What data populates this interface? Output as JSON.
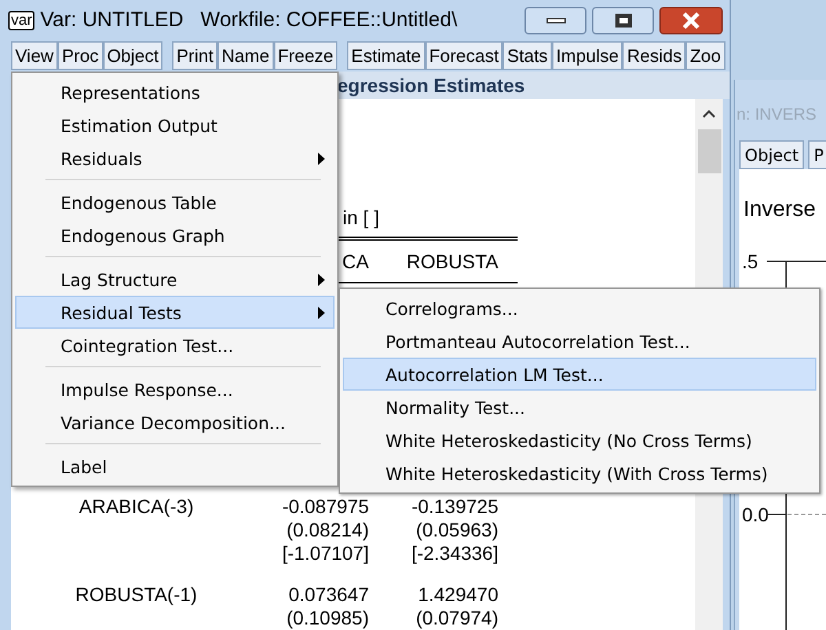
{
  "window": {
    "icon_text": "var",
    "title": "Var: UNTITLED   Workfile: COFFEE::Untitled\\"
  },
  "toolbar_groups": [
    [
      "View",
      "Proc",
      "Object"
    ],
    [
      "Print",
      "Name",
      "Freeze"
    ],
    [
      "Estimate",
      "Forecast",
      "Stats",
      "Impulse",
      "Resids",
      "Zoo"
    ]
  ],
  "output": {
    "header": "egression Estimates",
    "sample_text": "in [ ]",
    "columns": [
      "CA",
      "ROBUSTA"
    ],
    "rows": [
      {
        "label": "ARABICA(-3)",
        "cells": [
          [
            "-0.087975",
            "(0.08214)",
            "[-1.07107]"
          ],
          [
            "-0.139725",
            "(0.05963)",
            "[-2.34336]"
          ]
        ]
      },
      {
        "label": "ROBUSTA(-1)",
        "cells": [
          [
            "0.073647",
            "(0.10985)"
          ],
          [
            "1.429470",
            "(0.07974)"
          ]
        ]
      }
    ]
  },
  "view_menu": [
    {
      "kind": "item",
      "label": "Representations",
      "submenu": false,
      "selected": false
    },
    {
      "kind": "item",
      "label": "Estimation Output",
      "submenu": false,
      "selected": false
    },
    {
      "kind": "item",
      "label": "Residuals",
      "submenu": true,
      "selected": false
    },
    {
      "kind": "separator"
    },
    {
      "kind": "item",
      "label": "Endogenous Table",
      "submenu": false,
      "selected": false
    },
    {
      "kind": "item",
      "label": "Endogenous Graph",
      "submenu": false,
      "selected": false
    },
    {
      "kind": "separator"
    },
    {
      "kind": "item",
      "label": "Lag Structure",
      "submenu": true,
      "selected": false
    },
    {
      "kind": "item",
      "label": "Residual Tests",
      "submenu": true,
      "selected": true
    },
    {
      "kind": "item",
      "label": "Cointegration Test...",
      "submenu": false,
      "selected": false
    },
    {
      "kind": "separator"
    },
    {
      "kind": "item",
      "label": "Impulse Response...",
      "submenu": false,
      "selected": false
    },
    {
      "kind": "item",
      "label": "Variance Decomposition...",
      "submenu": false,
      "selected": false
    },
    {
      "kind": "separator"
    },
    {
      "kind": "item",
      "label": "Label",
      "submenu": false,
      "selected": false
    }
  ],
  "residual_tests_menu": [
    {
      "label": "Correlograms...",
      "selected": false
    },
    {
      "label": "Portmanteau Autocorrelation Test...",
      "selected": false
    },
    {
      "label": "Autocorrelation LM Test...",
      "selected": true
    },
    {
      "label": "Normality Test...",
      "selected": false
    },
    {
      "label": "White Heteroskedasticity (No Cross Terms)",
      "selected": false
    },
    {
      "label": "White Heteroskedasticity (With Cross Terms)",
      "selected": false
    }
  ],
  "background_window": {
    "title": "n: INVERS",
    "toolbar": [
      "Object",
      "P"
    ],
    "heading": "Inverse",
    "yticks": [
      ".5",
      "0.0"
    ]
  }
}
